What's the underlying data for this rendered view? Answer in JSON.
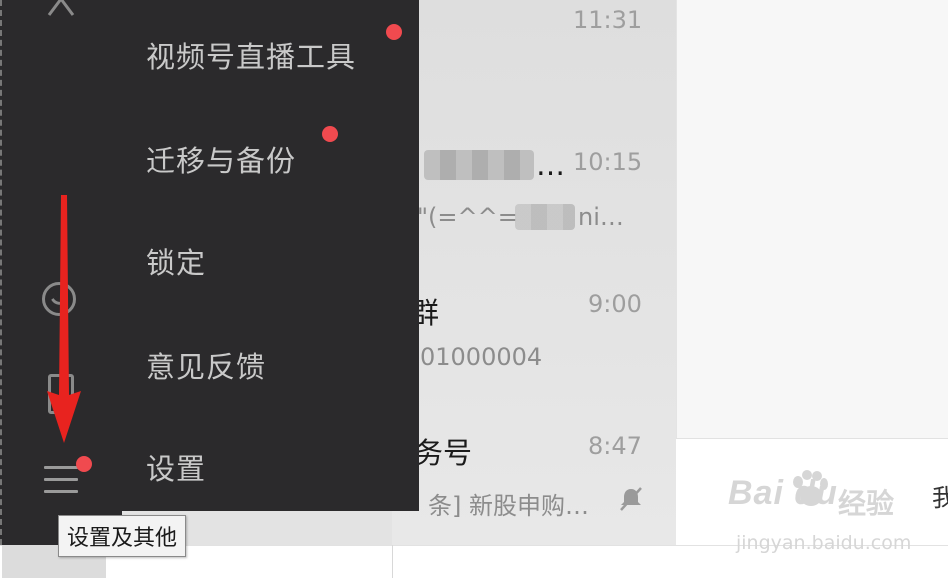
{
  "popup_menu": {
    "items": [
      {
        "label": "视频号直播工具",
        "badge": true
      },
      {
        "label": "迁移与备份",
        "badge": true
      },
      {
        "label": "锁定",
        "badge": false
      },
      {
        "label": "意见反馈",
        "badge": false
      },
      {
        "label": "设置",
        "badge": false
      }
    ]
  },
  "tooltip": "设置及其他",
  "chats": [
    {
      "time": "11:31",
      "name": "",
      "preview": ""
    },
    {
      "time": "10:15",
      "name": "…",
      "preview": "\"(=^^=",
      "preview_tail": "ni…"
    },
    {
      "time": "9:00",
      "name": "群",
      "preview": "01000004"
    },
    {
      "time": "8:47",
      "name": "务号",
      "preview": "条] 新股申购…",
      "muted": true
    }
  ],
  "main_partial_text": "我",
  "watermark": {
    "logo": "Bai du",
    "cn": "经验",
    "url": "jingyan.baidu.com"
  },
  "colors": {
    "sidebar_bg": "#2b2a2c",
    "badge_red": "#f04a4f",
    "arrow_red": "#e8231f"
  },
  "icons": [
    "collapse-icon",
    "mini-program-icon",
    "phone-icon",
    "menu-icon",
    "mute-icon"
  ]
}
